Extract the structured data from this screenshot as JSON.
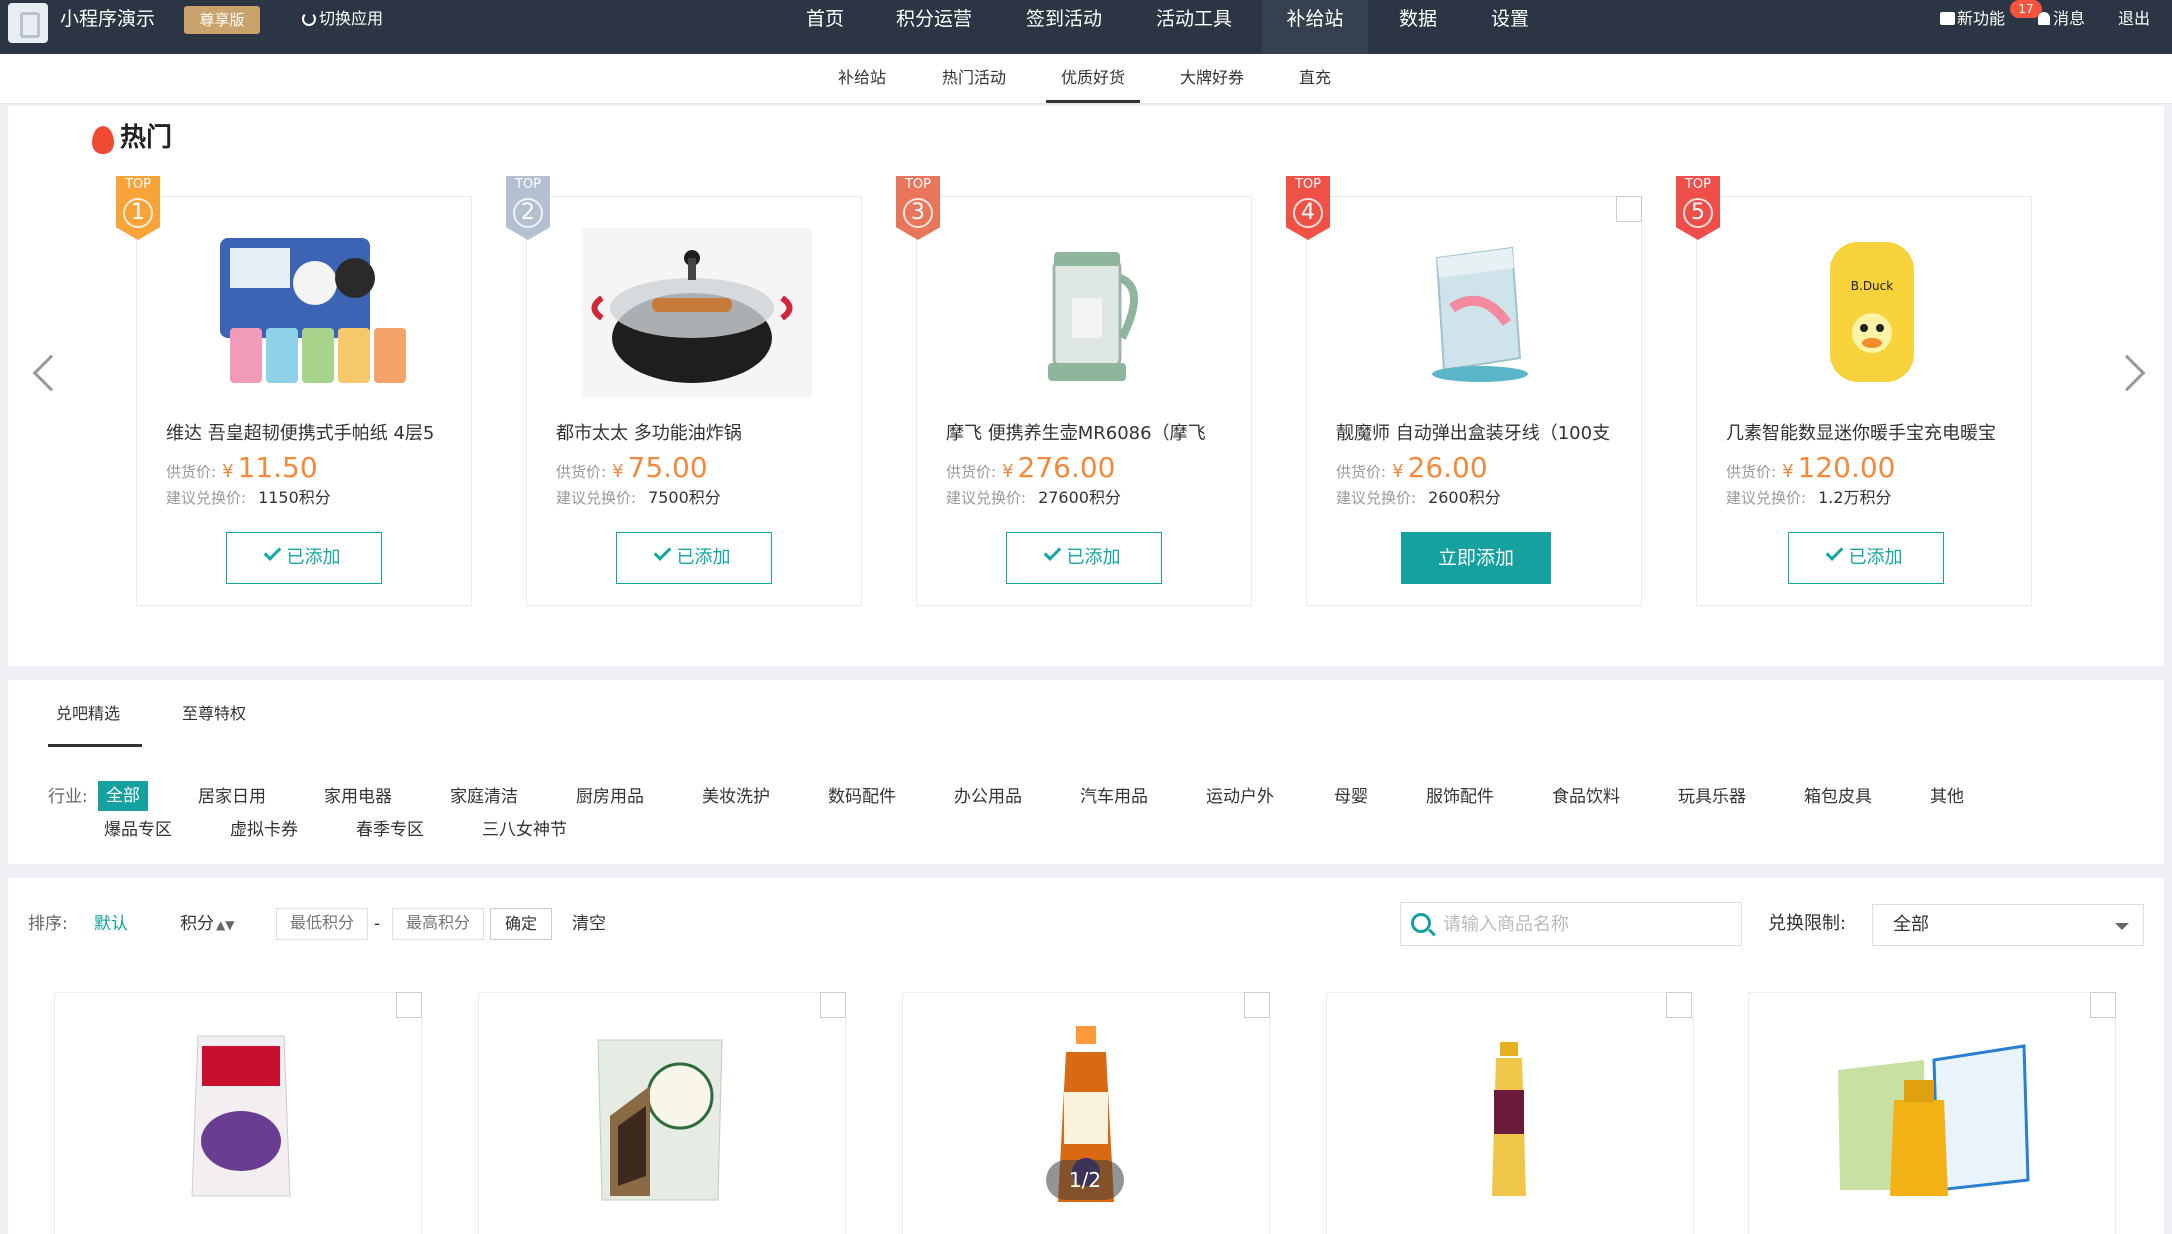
{
  "header": {
    "app_name": "小程序演示",
    "vip_label": "尊享版",
    "switch_app": "切换应用",
    "nav": [
      "首页",
      "积分运营",
      "签到活动",
      "活动工具",
      "补给站",
      "数据",
      "设置"
    ],
    "active_nav": "补给站",
    "new_feature": "新功能",
    "notice_count": "17",
    "messages": "消息",
    "logout": "退出"
  },
  "subnav": {
    "items": [
      "补给站",
      "热门活动",
      "优质好货",
      "大牌好券",
      "直充"
    ],
    "active": "优质好货"
  },
  "hot": {
    "title": "热门",
    "top_label": "TOP",
    "price_label": "供货价:",
    "suggest_label": "建议兑换价:",
    "currency": "¥",
    "added_label": "已添加",
    "add_label": "立即添加",
    "items": [
      {
        "rank": "1",
        "name": "维达 吾皇超韧便携式手帕纸 4层5",
        "price": "11.50",
        "points": "1150积分",
        "added": true
      },
      {
        "rank": "2",
        "name": "都市太太 多功能油炸锅",
        "price": "75.00",
        "points": "7500积分",
        "added": true
      },
      {
        "rank": "3",
        "name": "摩飞 便携养生壶MR6086（摩飞",
        "price": "276.00",
        "points": "27600积分",
        "added": true
      },
      {
        "rank": "4",
        "name": "靓魔师 自动弹出盒装牙线（100支",
        "price": "26.00",
        "points": "2600积分",
        "added": false
      },
      {
        "rank": "5",
        "name": "几素智能数显迷你暖手宝充电暖宝",
        "price": "120.00",
        "points": "1.2万积分",
        "added": true
      }
    ]
  },
  "tabs": {
    "items": [
      "兑吧精选",
      "至尊特权"
    ],
    "active": "兑吧精选"
  },
  "categories": {
    "label": "行业:",
    "row1": [
      "全部",
      "居家日用",
      "家用电器",
      "家庭清洁",
      "厨房用品",
      "美妆洗护",
      "数码配件",
      "办公用品",
      "汽车用品",
      "运动户外",
      "母婴",
      "服饰配件",
      "食品饮料",
      "玩具乐器",
      "箱包皮具",
      "其他"
    ],
    "row2": [
      "爆品专区",
      "虚拟卡券",
      "春季专区",
      "三八女神节"
    ],
    "active": "全部"
  },
  "filters": {
    "sort_label": "排序:",
    "sort_default": "默认",
    "sort_points": "积分",
    "min_placeholder": "最低积分",
    "dash": "-",
    "max_placeholder": "最高积分",
    "confirm": "确定",
    "clear": "清空",
    "search_placeholder": "请输入商品名称",
    "limit_label": "兑换限制:",
    "limit_value": "全部"
  },
  "grid": {
    "pager": "1/2"
  },
  "colors": {
    "accent": "#14a1a0",
    "price": "#f5893a",
    "topbar": "#2b3543"
  }
}
